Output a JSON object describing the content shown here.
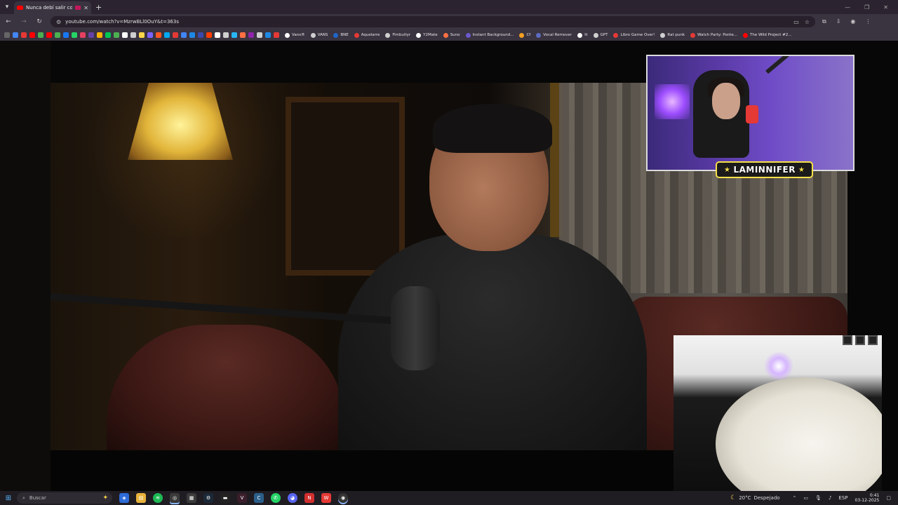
{
  "browser": {
    "tab": {
      "title": "Nunca debí salir con MI M..."
    },
    "address": {
      "url": "youtube.com/watch?v=MzrwBLl0OuY&t=363s"
    },
    "bookmarks": [
      {
        "label": "Vans®",
        "color": "#ffffff"
      },
      {
        "label": "VANS",
        "color": "#cfcfcf"
      },
      {
        "label": "BNE",
        "color": "#1e66c9"
      },
      {
        "label": "Aquelarre",
        "color": "#e53935"
      },
      {
        "label": "Fimbultyr",
        "color": "#cfcfcf"
      },
      {
        "label": "Y2Mate",
        "color": "#ffffff"
      },
      {
        "label": "Suno",
        "color": "#ff7043"
      },
      {
        "label": "Instant Background...",
        "color": "#6a5acd"
      },
      {
        "label": "Cf",
        "color": "#f4a021"
      },
      {
        "label": "Vocal Remover",
        "color": "#5c6bc0"
      },
      {
        "label": "tt",
        "color": "#ffffff"
      },
      {
        "label": "GPT",
        "color": "#cfcfcf"
      },
      {
        "label": "Libro Game Over!",
        "color": "#e53935"
      },
      {
        "label": "Rat punk",
        "color": "#cfcfcf"
      },
      {
        "label": "Watch Party: Ponte...",
        "color": "#e53935"
      },
      {
        "label": "The Wild Project #2...",
        "color": "#ff0000"
      }
    ],
    "bookmark_icon_colors": [
      "#4285f4",
      "#e53935",
      "#ff0000",
      "#4caf50",
      "#ff0000",
      "#4caf50",
      "#1877f2",
      "#25d366",
      "#e4405f",
      "#6441a5",
      "#ffb300",
      "#00c853",
      "#4caf50",
      "#ffffff",
      "#cfcfcf",
      "#ffd54a",
      "#7b61ff",
      "#ff5722",
      "#03a9f4",
      "#e53935",
      "#4285f4",
      "#1e88e5",
      "#3949ab",
      "#ff3d00",
      "#ffffff",
      "#cfcfcf",
      "#29b6f6",
      "#ff7043",
      "#8e24aa",
      "#cfcfcf",
      "#1e88e5",
      "#e53935"
    ]
  },
  "overlay": {
    "brand": "LAMINNIFER"
  },
  "taskbar": {
    "search_placeholder": "Buscar",
    "weather": {
      "temp": "20°C",
      "condition": "Despejado"
    },
    "lang": "ESP",
    "time": "0:41",
    "date": "03-12-2025"
  },
  "colors": {
    "youtube_red": "#ff0000",
    "brand_yellow": "#f6e04a",
    "taskbar_bg": "#1f1c22",
    "chrome_bg": "#3a3340"
  }
}
